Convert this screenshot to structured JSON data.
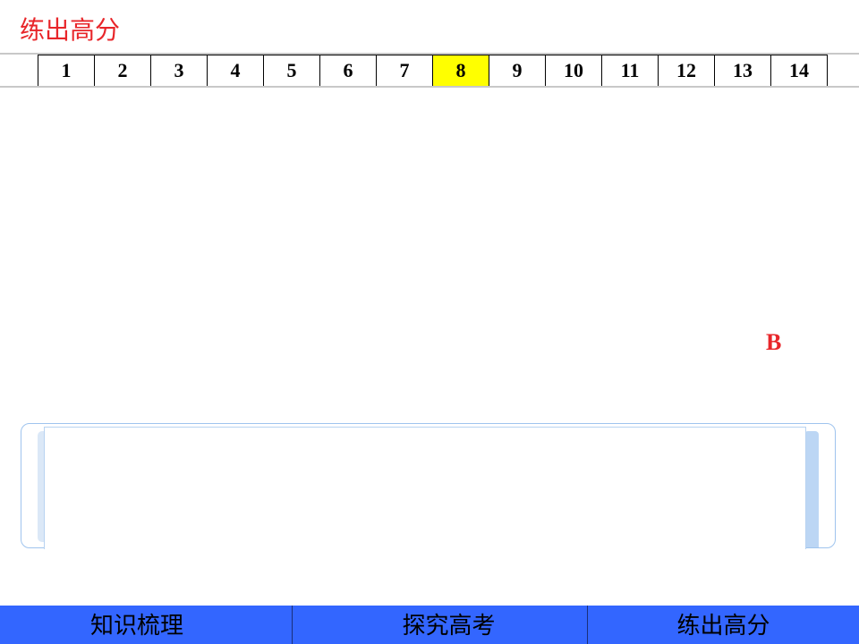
{
  "header": {
    "section_title": "练出高分"
  },
  "question_numbers": [
    "1",
    "2",
    "3",
    "4",
    "5",
    "6",
    "7",
    "8",
    "9",
    "10",
    "11",
    "12",
    "13",
    "14"
  ],
  "current_question": "8",
  "answer": "B",
  "bottom_nav": {
    "items": [
      {
        "label": "知识梳理"
      },
      {
        "label": "探究高考"
      },
      {
        "label": "练出高分"
      }
    ]
  },
  "colors": {
    "title_red": "#e8262a",
    "highlight_yellow": "#ffff00",
    "nav_blue": "#3366ff"
  }
}
